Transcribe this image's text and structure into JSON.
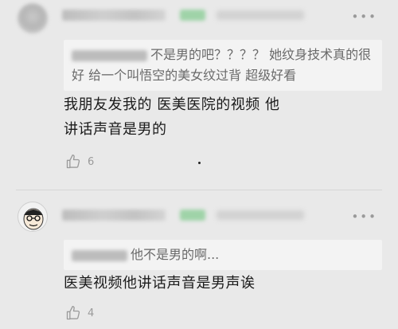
{
  "comments": [
    {
      "quote_text": "不是男的吧？？？？ 她纹身技术真的很好 给一个叫悟空的美女纹过背 超级好看",
      "body_line1": "我朋友发我的 医美医院的视频 他",
      "body_line2": "讲话声音是男的",
      "like_count": "6"
    },
    {
      "quote_text": "他不是男的啊...",
      "body": "医美视频他讲话声音是男声诶",
      "like_count": "4"
    }
  ],
  "icons": {
    "more": "more-icon",
    "like": "thumbs-up-icon",
    "avatar": "avatar"
  },
  "more_glyph": "•••"
}
